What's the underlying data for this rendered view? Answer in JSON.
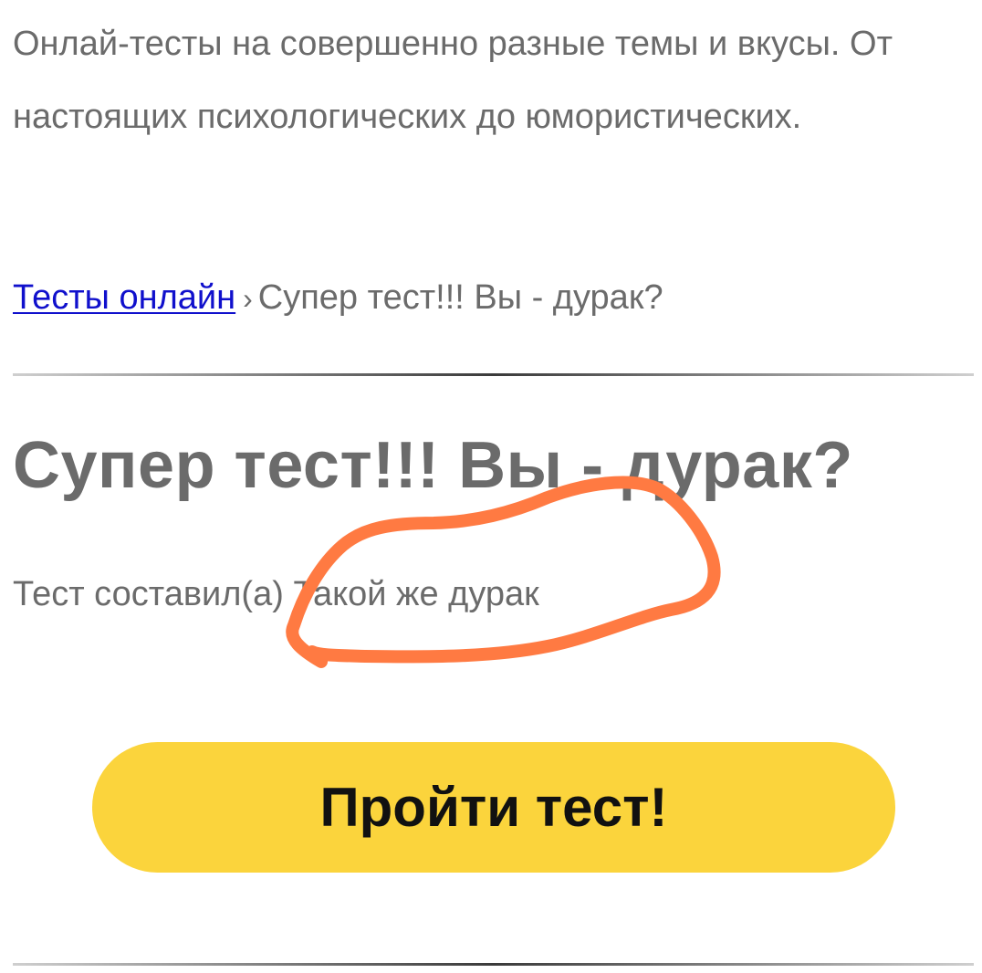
{
  "intro": {
    "text": "Онлай-тесты на совершенно разные темы и вкусы. От настоящих психологических до юмористических."
  },
  "breadcrumb": {
    "link_label": "Тесты онлайн",
    "separator": "›",
    "current": "Супер тест!!! Вы - дурак?"
  },
  "test": {
    "title": "Супер тест!!! Вы - дурак?",
    "author_prefix": "Тест составил(а)",
    "author_name": "Такой же дурак",
    "start_button_label": "Пройти тест!"
  },
  "colors": {
    "text": "#6b6b6b",
    "link": "#1010cc",
    "button_bg": "#fbd43c",
    "annotation_stroke": "#ff7a42"
  }
}
